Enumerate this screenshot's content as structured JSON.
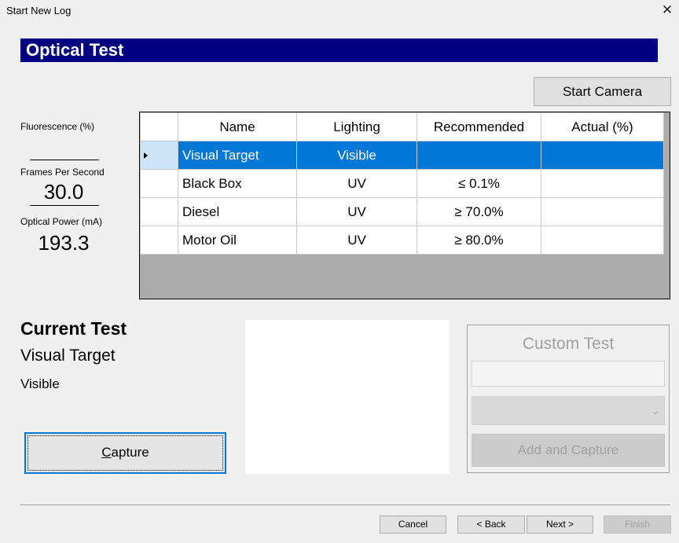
{
  "window": {
    "title": "Start New Log",
    "close_glyph": "✕"
  },
  "banner": {
    "title": "Optical Test"
  },
  "toolbar": {
    "start_camera_label": "Start Camera"
  },
  "metrics": {
    "fluorescence_label": "Fluorescence (%)",
    "fluorescence_value": "",
    "fps_label": "Frames Per Second",
    "fps_value": "30.0",
    "power_label": "Optical Power (mA)",
    "power_value": "193.3"
  },
  "grid": {
    "columns": [
      "Name",
      "Lighting",
      "Recommended",
      "Actual (%)"
    ],
    "rows": [
      {
        "name": "Visual Target",
        "lighting": "Visible",
        "recommended": "",
        "actual": "",
        "selected": true
      },
      {
        "name": "Black Box",
        "lighting": "UV",
        "recommended": "≤ 0.1%",
        "actual": ""
      },
      {
        "name": "Diesel",
        "lighting": "UV",
        "recommended": "≥ 70.0%",
        "actual": ""
      },
      {
        "name": "Motor Oil",
        "lighting": "UV",
        "recommended": "≥ 80.0%",
        "actual": ""
      }
    ]
  },
  "current_test": {
    "heading": "Current Test",
    "name": "Visual Target",
    "lighting": "Visible",
    "capture_label": "Capture"
  },
  "custom_test": {
    "title": "Custom Test",
    "name_value": "",
    "lighting_value": "",
    "add_label": "Add and Capture"
  },
  "footer": {
    "cancel_label": "Cancel",
    "back_label": "< Back",
    "next_label": "Next >",
    "finish_label": "Finish"
  },
  "colors": {
    "banner": "#000080",
    "selection": "#0078d7",
    "grid_empty": "#ababab"
  }
}
